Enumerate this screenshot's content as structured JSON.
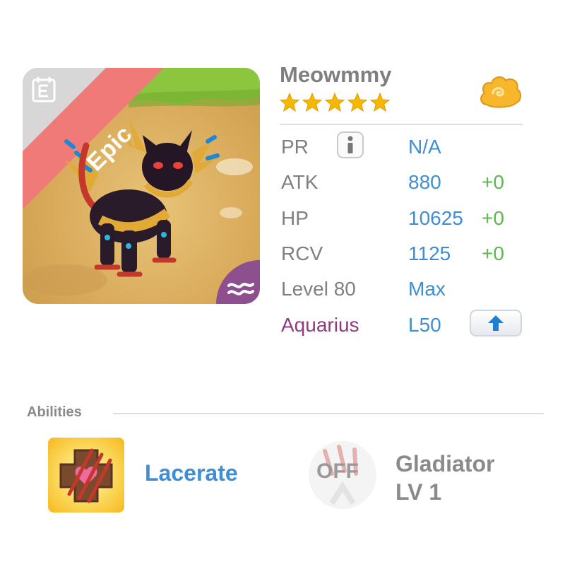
{
  "monster": {
    "name": "Meowmmy",
    "stars": 5,
    "rarity": "Epic",
    "element": "water",
    "portrait_icon": "monster-portrait",
    "book_icon": "codex-book-icon",
    "currency_icon": "cloud-gold-icon"
  },
  "stats": {
    "pr": {
      "label": "PR",
      "value": "N/A"
    },
    "atk": {
      "label": "ATK",
      "value": "880",
      "bonus": "+0"
    },
    "hp": {
      "label": "HP",
      "value": "10625",
      "bonus": "+0"
    },
    "rcv": {
      "label": "RCV",
      "value": "1125",
      "bonus": "+0"
    },
    "level": {
      "label": "Level 80",
      "value": "Max"
    },
    "constellation": {
      "label": "Aquarius",
      "value": "L50"
    }
  },
  "abilities": {
    "section_label": "Abilities",
    "items": [
      {
        "name": "Lacerate",
        "icon": "lacerate-claw-icon",
        "enabled": true
      },
      {
        "name_line1": "Gladiator",
        "name_line2": "LV 1",
        "status": "OFF",
        "icon": "gladiator-claw-icon",
        "enabled": false
      }
    ]
  },
  "colors": {
    "value_blue": "#3f8ed4",
    "bonus_green": "#5fb84f",
    "constellation_purple": "#8e3d7c",
    "epic_banner": "#f07a78",
    "star_gold": "#f5b800"
  }
}
